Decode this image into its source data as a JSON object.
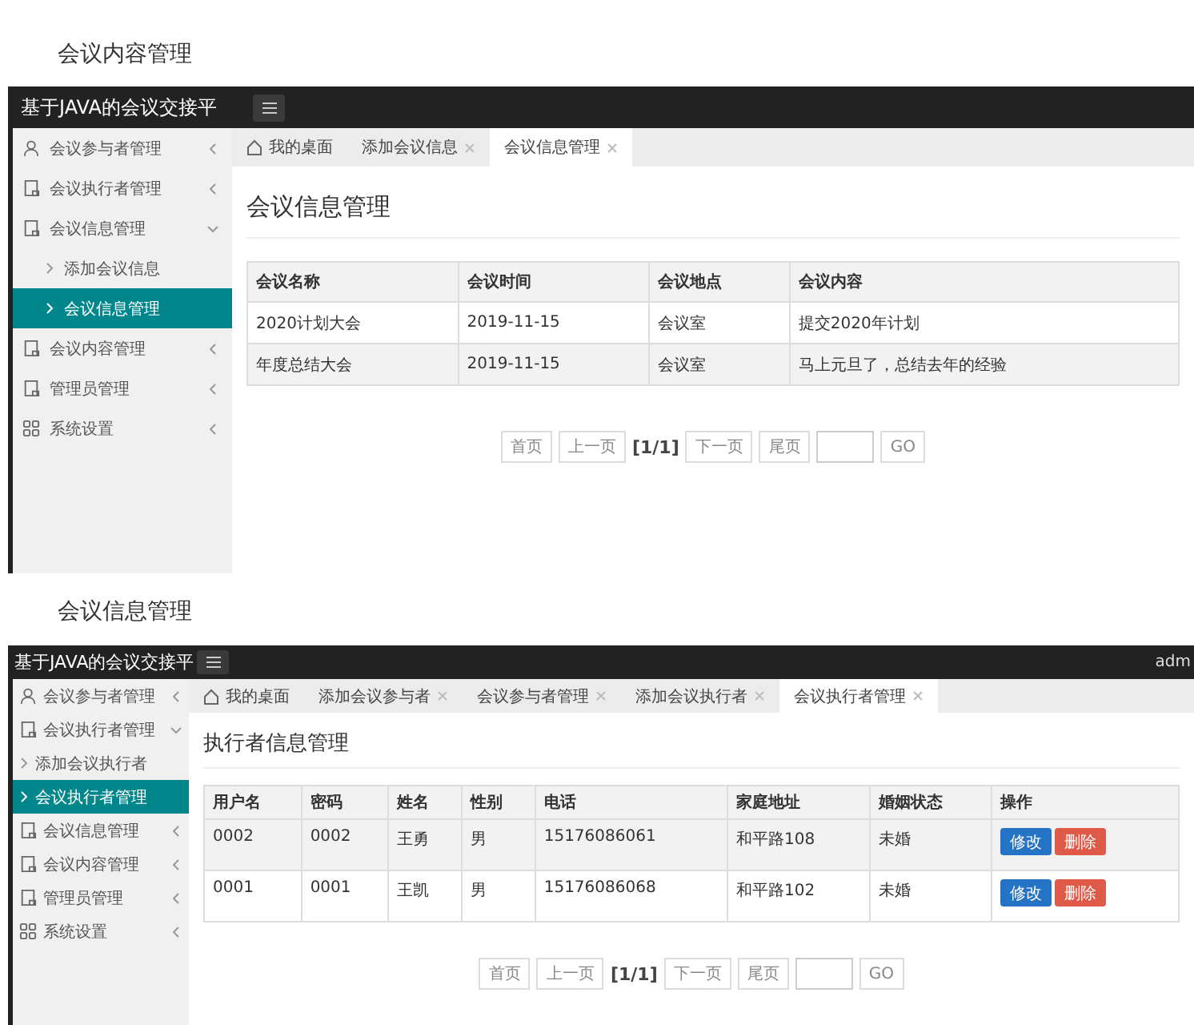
{
  "sections": [
    {
      "caption": "会议内容管理",
      "screen": {
        "app_title": "基于JAVA的会议交接平",
        "sidebar": [
          {
            "label": "会议参与者管理",
            "kind": "user",
            "expanded": false
          },
          {
            "label": "会议执行者管理",
            "kind": "doc",
            "expanded": false
          },
          {
            "label": "会议信息管理",
            "kind": "doc",
            "expanded": true,
            "children": [
              {
                "label": "添加会议信息",
                "selected": false
              },
              {
                "label": "会议信息管理",
                "selected": true
              }
            ]
          },
          {
            "label": "会议内容管理",
            "kind": "doc",
            "expanded": false
          },
          {
            "label": "管理员管理",
            "kind": "doc",
            "expanded": false
          },
          {
            "label": "系统设置",
            "kind": "grid",
            "expanded": false
          }
        ],
        "tabs": [
          {
            "label": "我的桌面",
            "kind": "home",
            "selected": false
          },
          {
            "label": "添加会议信息",
            "kind": "closable",
            "selected": false
          },
          {
            "label": "会议信息管理",
            "kind": "closable",
            "selected": true
          }
        ],
        "page_title": "会议信息管理",
        "table": {
          "columns": [
            "会议名称",
            "会议时间",
            "会议地点",
            "会议内容"
          ],
          "rows": [
            {
              "cells": [
                "2020计划大会",
                "2019-11-15",
                "会议室",
                "提交2020年计划"
              ],
              "highlighted": false
            },
            {
              "cells": [
                "年度总结大会",
                "2019-11-15",
                "会议室",
                "马上元旦了，总结去年的经验"
              ],
              "highlighted": true
            }
          ]
        },
        "pagination": {
          "first": "首页",
          "prev": "上一页",
          "page": "[1/1]",
          "next": "下一页",
          "last": "尾页",
          "go": "GO"
        }
      }
    },
    {
      "caption": "会议信息管理",
      "screen": {
        "app_title": "基于JAVA的会议交接平",
        "user": "adm",
        "sidebar": [
          {
            "label": "会议参与者管理",
            "kind": "user",
            "expanded": false
          },
          {
            "label": "会议执行者管理",
            "kind": "doc",
            "expanded": true,
            "children": [
              {
                "label": "添加会议执行者",
                "selected": false
              },
              {
                "label": "会议执行者管理",
                "selected": true
              }
            ]
          },
          {
            "label": "会议信息管理",
            "kind": "doc",
            "expanded": false
          },
          {
            "label": "会议内容管理",
            "kind": "doc",
            "expanded": false
          },
          {
            "label": "管理员管理",
            "kind": "doc",
            "expanded": false
          },
          {
            "label": "系统设置",
            "kind": "grid",
            "expanded": false
          }
        ],
        "tabs": [
          {
            "label": "我的桌面",
            "kind": "home",
            "selected": false
          },
          {
            "label": "添加会议参与者",
            "kind": "closable",
            "selected": false
          },
          {
            "label": "会议参与者管理",
            "kind": "closable",
            "selected": false
          },
          {
            "label": "添加会议执行者",
            "kind": "closable",
            "selected": false
          },
          {
            "label": "会议执行者管理",
            "kind": "closable",
            "selected": true
          }
        ],
        "page_title": "执行者信息管理",
        "table": {
          "columns": [
            "用户名",
            "密码",
            "姓名",
            "性别",
            "电话",
            "家庭地址",
            "婚姻状态",
            "操作"
          ],
          "rows": [
            {
              "cells": [
                "0002",
                "0002",
                "王勇",
                "男",
                "15176086061",
                "和平路108",
                "未婚"
              ],
              "highlighted": true,
              "actions": [
                {
                  "label": "修改",
                  "kind": "edit"
                },
                {
                  "label": "删除",
                  "kind": "delete"
                }
              ]
            },
            {
              "cells": [
                "0001",
                "0001",
                "王凯",
                "男",
                "15176086068",
                "和平路102",
                "未婚"
              ],
              "highlighted": false,
              "actions": [
                {
                  "label": "修改",
                  "kind": "edit"
                },
                {
                  "label": "删除",
                  "kind": "delete"
                }
              ]
            }
          ]
        },
        "pagination": {
          "first": "首页",
          "prev": "上一页",
          "page": "[1/1]",
          "next": "下一页",
          "last": "尾页",
          "go": "GO"
        }
      }
    }
  ]
}
